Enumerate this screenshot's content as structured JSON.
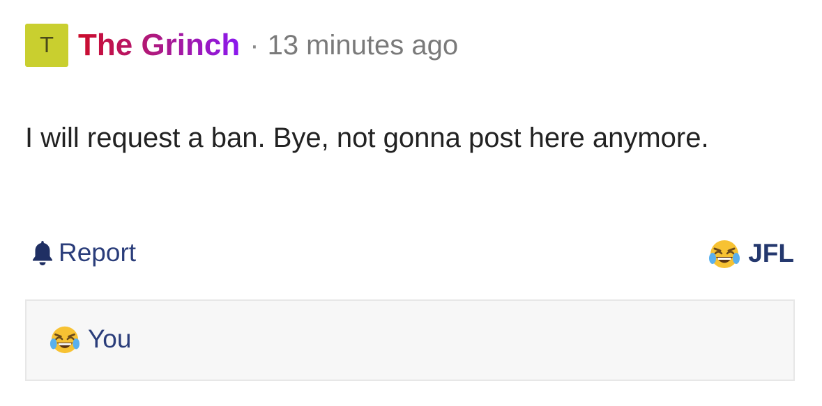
{
  "post": {
    "avatar_initial": "T",
    "avatar_color": "#c9cf2f",
    "author": "The Grinch",
    "separator": "·",
    "timestamp": "13 minutes ago",
    "body": "I will request a ban. Bye, not gonna post here anymore."
  },
  "actions": {
    "report_icon": "bell-icon",
    "report_label": "Report",
    "reaction_icon": "laughing-crying-emoji-icon",
    "reaction_label": "JFL"
  },
  "reactions": {
    "items": [
      {
        "icon": "laughing-crying-emoji-icon",
        "user": "You"
      }
    ]
  },
  "colors": {
    "author_gradient": [
      "#cc0c2a",
      "#b0197c",
      "#8a18f0"
    ],
    "link": "#2a3d7a",
    "reactions_bg": "#f7f7f7"
  }
}
